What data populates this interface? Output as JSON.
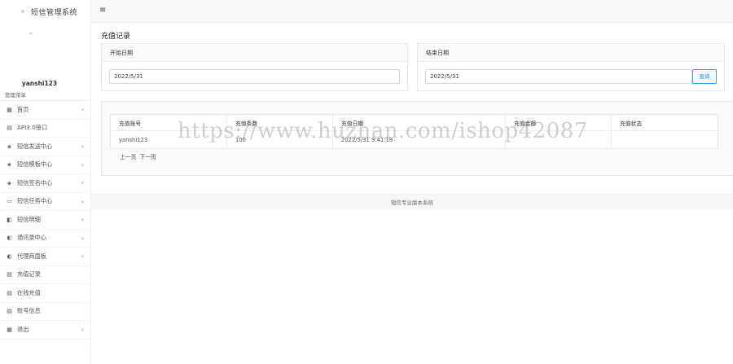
{
  "app": {
    "title": "短信管理系统"
  },
  "user": {
    "name": "yanshi123"
  },
  "sidebar": {
    "heading": "管理菜单",
    "items": [
      {
        "label": "首页",
        "icon": "dashboard-icon",
        "glyph": "▦",
        "has_children": true
      },
      {
        "label": "API3.0接口",
        "icon": "calendar-icon",
        "glyph": "▤",
        "has_children": false
      },
      {
        "label": "短信发送中心",
        "icon": "layers-icon",
        "glyph": "◈",
        "has_children": true
      },
      {
        "label": "短信模板中心",
        "icon": "layers-icon",
        "glyph": "◈",
        "has_children": true
      },
      {
        "label": "短信签名中心",
        "icon": "layers-icon",
        "glyph": "◈",
        "has_children": true
      },
      {
        "label": "短信任务中心",
        "icon": "briefcase-icon",
        "glyph": "▭",
        "has_children": true
      },
      {
        "label": "短信明细",
        "icon": "report-icon",
        "glyph": "◧",
        "has_children": true
      },
      {
        "label": "通讯录中心",
        "icon": "half-circle-icon",
        "glyph": "◐",
        "has_children": true
      },
      {
        "label": "代理商面板",
        "icon": "half-circle-icon",
        "glyph": "◐",
        "has_children": true
      },
      {
        "label": "充值记录",
        "icon": "calendar-icon",
        "glyph": "▤",
        "has_children": false
      },
      {
        "label": "在线充值",
        "icon": "calendar-icon",
        "glyph": "▤",
        "has_children": false
      },
      {
        "label": "账号信息",
        "icon": "calendar-icon",
        "glyph": "▤",
        "has_children": false
      },
      {
        "label": "退出",
        "icon": "table-icon",
        "glyph": "▦",
        "has_children": true
      }
    ]
  },
  "topbar": {
    "menu_glyph": "≡"
  },
  "page": {
    "title": "充值记录",
    "start_panel": {
      "label": "开始日期",
      "value": "2022/5/31"
    },
    "end_panel": {
      "label": "结束日期",
      "value": "2022/5/31",
      "button": "查询"
    }
  },
  "table": {
    "headers": [
      "充值账号",
      "充值条数",
      "充值日期",
      "充值金额",
      "充值状态"
    ],
    "rows": [
      [
        "yanshi123",
        "100",
        "2022/5/31 9:41:19",
        "",
        ""
      ]
    ]
  },
  "pager": {
    "prev": "上一页",
    "next": "下一页"
  },
  "footer": {
    "text": "短信专业版本系统"
  },
  "watermark": {
    "text": "https://www.huzhan.com/ishop42087"
  },
  "colors": {
    "accent": "#2a8fd6",
    "topbar_bg": "#f8f9fb"
  }
}
